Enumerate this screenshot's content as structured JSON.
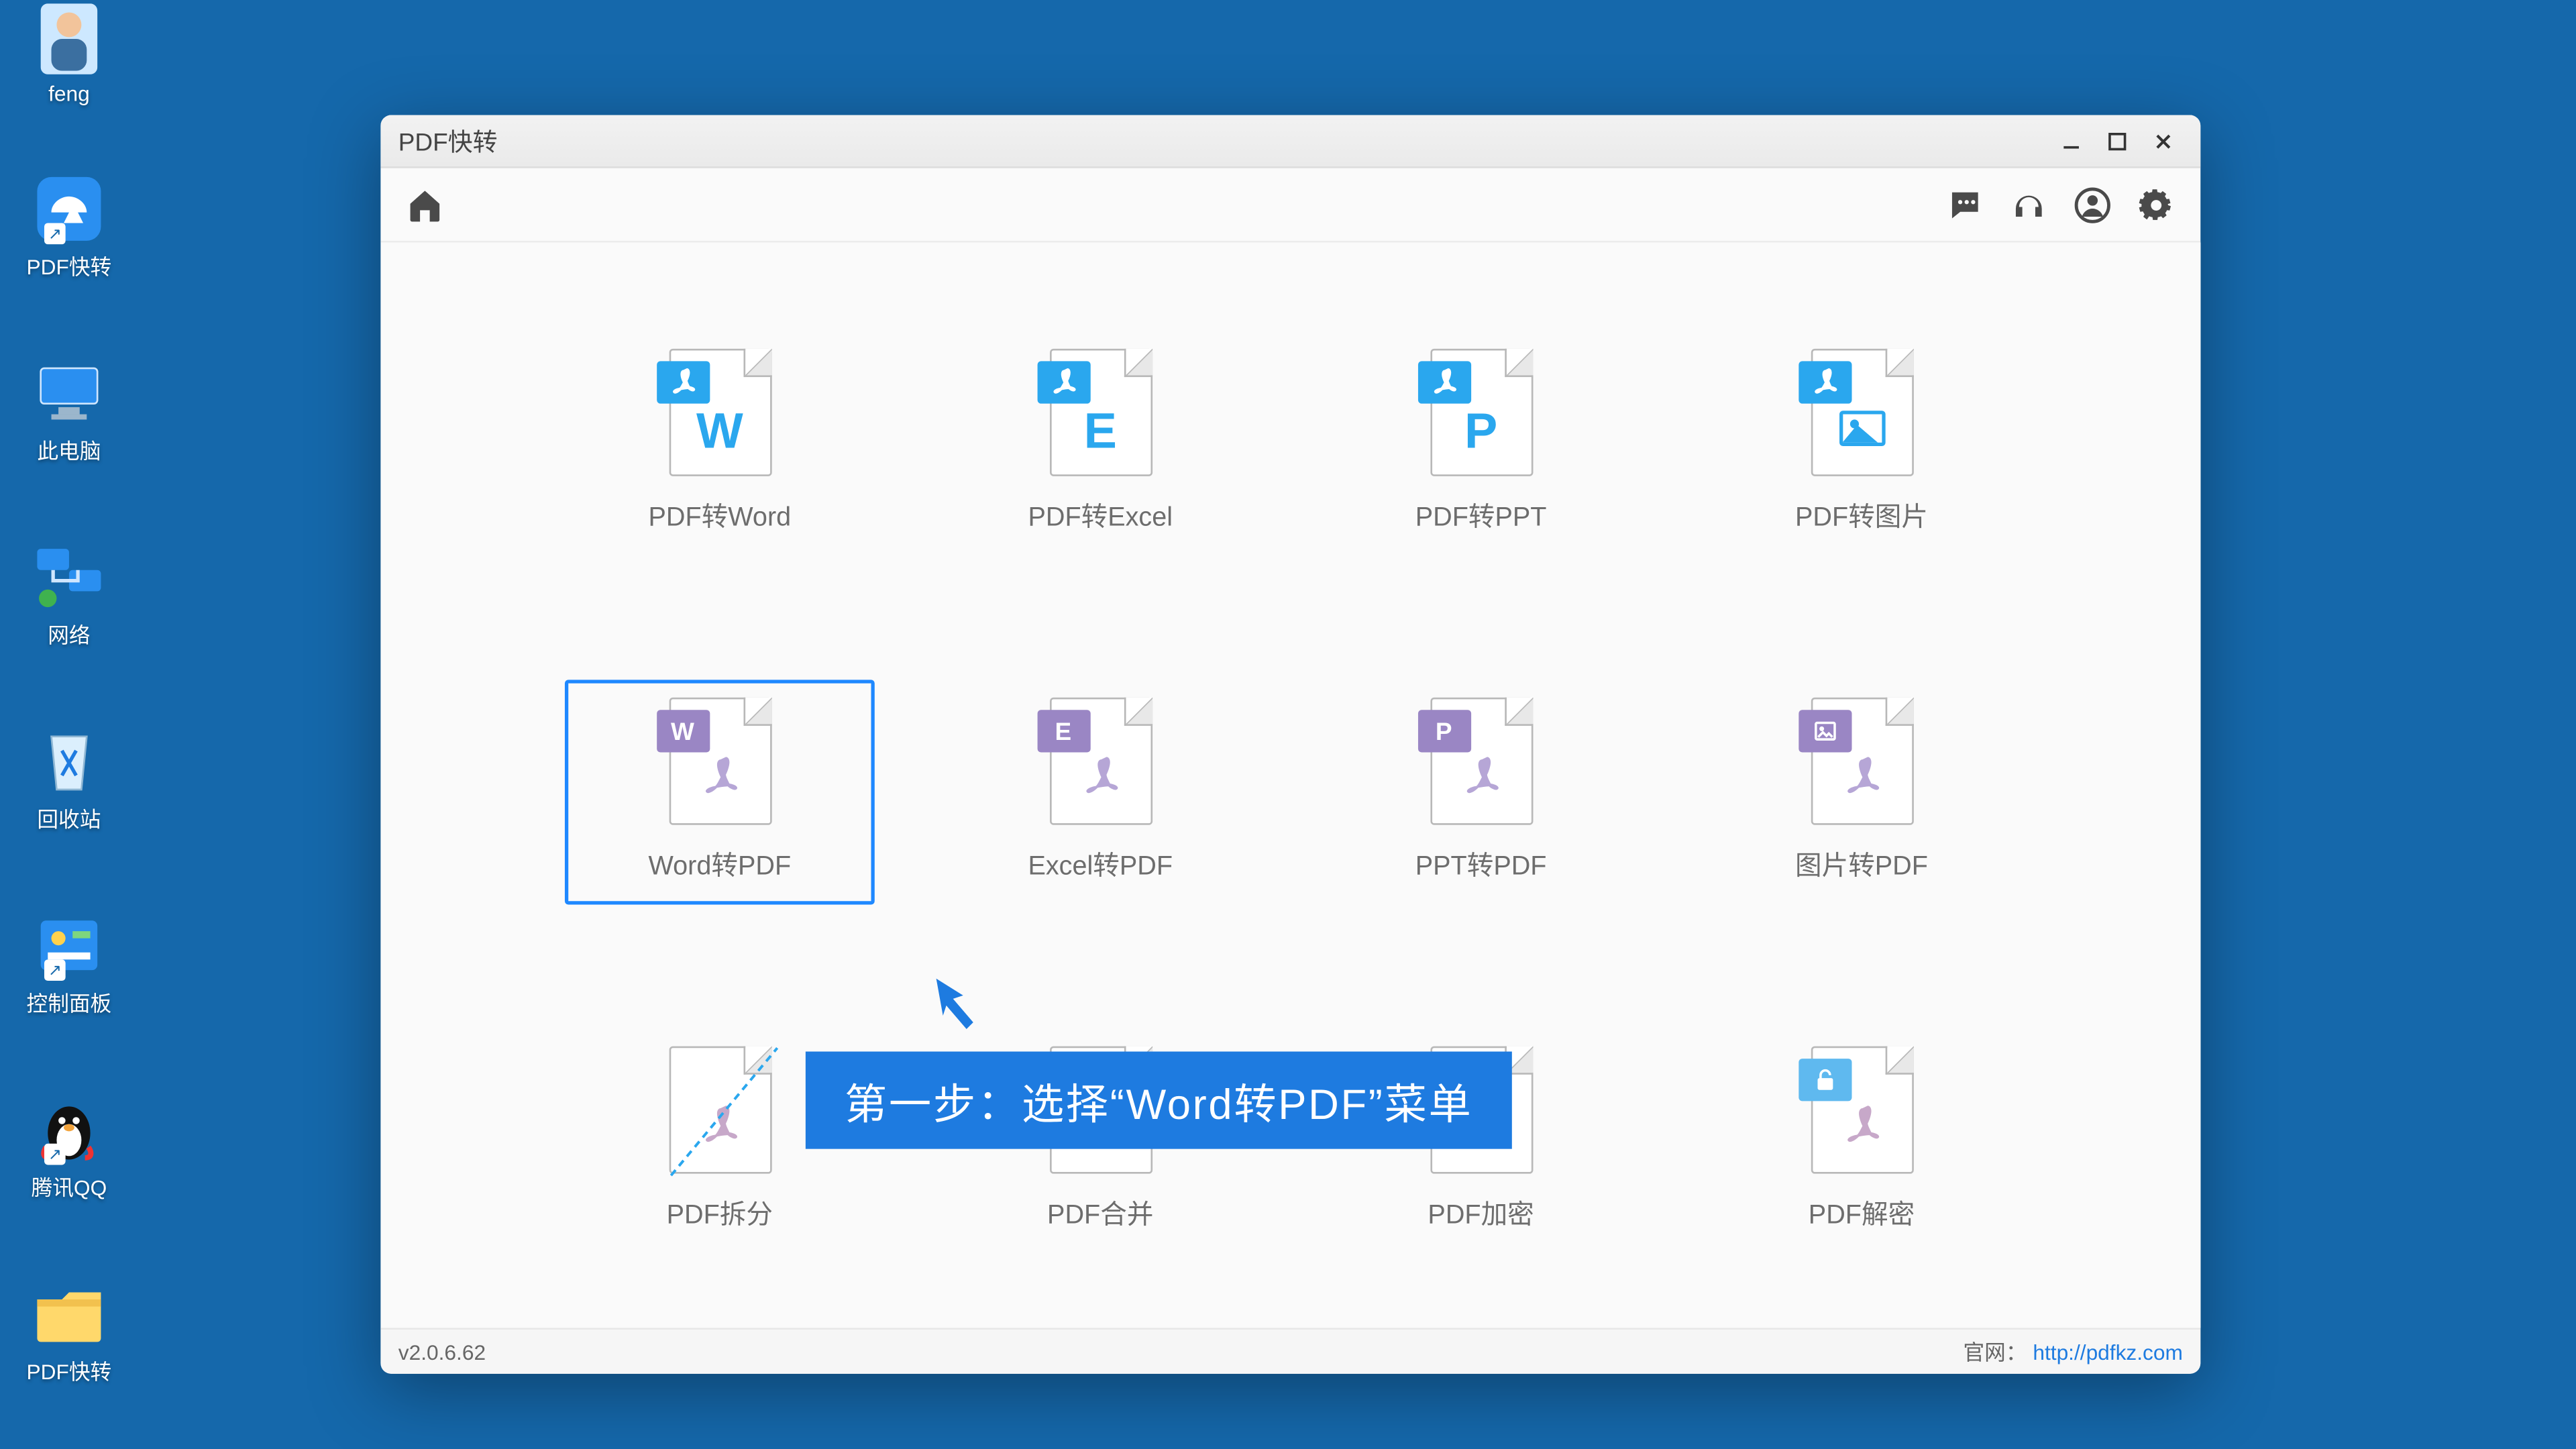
{
  "desktop": {
    "icons": [
      {
        "id": "user-folder",
        "label": "feng"
      },
      {
        "id": "pdf-app-shortcut",
        "label": "PDF快转"
      },
      {
        "id": "this-pc",
        "label": "此电脑"
      },
      {
        "id": "network",
        "label": "网络"
      },
      {
        "id": "recycle-bin",
        "label": "回收站"
      },
      {
        "id": "control-panel",
        "label": "控制面板"
      },
      {
        "id": "tencent-qq",
        "label": "腾讯QQ"
      },
      {
        "id": "pdf-folder",
        "label": "PDF快转"
      }
    ]
  },
  "window": {
    "title": "PDF快转",
    "toolbar": {
      "home": "home-icon",
      "right": [
        "chat-icon",
        "headphones-icon",
        "user-icon",
        "gear-icon"
      ]
    },
    "tools": [
      {
        "id": "pdf-to-word",
        "label": "PDF转Word",
        "fromTag": "pdf",
        "big": "W",
        "color": "blue",
        "kind": "letter"
      },
      {
        "id": "pdf-to-excel",
        "label": "PDF转Excel",
        "fromTag": "pdf",
        "big": "E",
        "color": "blue",
        "kind": "letter"
      },
      {
        "id": "pdf-to-ppt",
        "label": "PDF转PPT",
        "fromTag": "pdf",
        "big": "P",
        "color": "blue",
        "kind": "letter"
      },
      {
        "id": "pdf-to-image",
        "label": "PDF转图片",
        "fromTag": "pdf",
        "big": "",
        "color": "blue",
        "kind": "image"
      },
      {
        "id": "word-to-pdf",
        "label": "Word转PDF",
        "fromTag": "W",
        "big": "",
        "color": "purple",
        "kind": "adobe",
        "selected": true
      },
      {
        "id": "excel-to-pdf",
        "label": "Excel转PDF",
        "fromTag": "E",
        "big": "",
        "color": "purple",
        "kind": "adobe"
      },
      {
        "id": "ppt-to-pdf",
        "label": "PPT转PDF",
        "fromTag": "P",
        "big": "",
        "color": "purple",
        "kind": "adobe"
      },
      {
        "id": "image-to-pdf",
        "label": "图片转PDF",
        "fromTag": "img",
        "big": "",
        "color": "purple",
        "kind": "adobe"
      },
      {
        "id": "pdf-split",
        "label": "PDF拆分",
        "fromTag": "",
        "big": "",
        "color": "grey",
        "kind": "split"
      },
      {
        "id": "pdf-merge",
        "label": "PDF合并",
        "fromTag": "",
        "big": "",
        "color": "grey",
        "kind": "merge"
      },
      {
        "id": "pdf-encrypt",
        "label": "PDF加密",
        "fromTag": "lock",
        "big": "",
        "color": "orange",
        "kind": "adobe"
      },
      {
        "id": "pdf-decrypt",
        "label": "PDF解密",
        "fromTag": "unlock",
        "big": "",
        "color": "lblue",
        "kind": "adobe"
      }
    ],
    "statusbar": {
      "version": "v2.0.6.62",
      "site_label": "官网：",
      "site_url_text": "http://pdfkz.com"
    }
  },
  "annotation": {
    "text": "第一步：选择“Word转PDF”菜单"
  }
}
